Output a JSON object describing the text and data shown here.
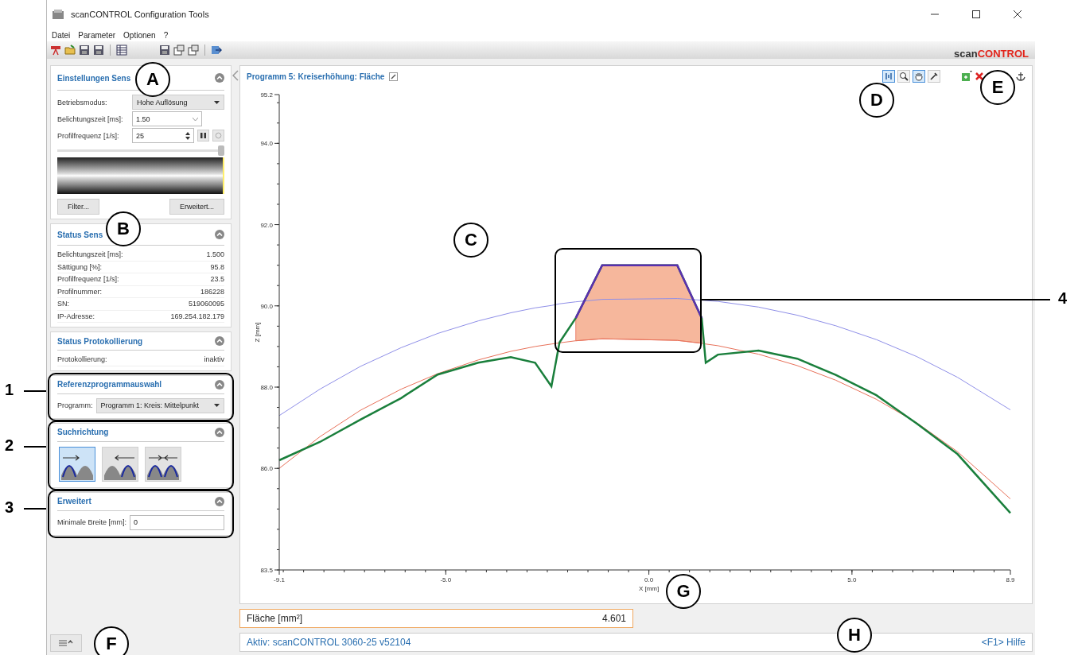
{
  "window": {
    "title": "scanCONTROL Configuration Tools"
  },
  "menu": [
    "Datei",
    "Parameter",
    "Optionen",
    "?"
  ],
  "logo": {
    "prefix": "scan",
    "suffix": "CONTROL"
  },
  "sensor_settings": {
    "title": "Einstellungen Sens",
    "expanded": true,
    "mode": {
      "label": "Betriebsmodus:",
      "value": "Hohe Auflösung"
    },
    "exposure": {
      "label": "Belichtungszeit [ms]:",
      "value": "1.50"
    },
    "frequency": {
      "label": "Profilfrequenz [1/s]:",
      "value": "25"
    },
    "slider": {
      "level": 1
    },
    "buttons": [
      "Filter...",
      "Erweitert..."
    ]
  },
  "sensor_status": {
    "title": "Status Sens",
    "expanded": true,
    "rows": [
      {
        "label": "Belichtungszeit [ms]:",
        "value": "1.500"
      },
      {
        "label": "Sättigung [%]:",
        "value": "95.8"
      },
      {
        "label": "Profilfrequenz [1/s]:",
        "value": "23.5"
      },
      {
        "label": "Profilnummer:",
        "value": "186228"
      },
      {
        "label": "SN:",
        "value": "519060095"
      },
      {
        "label": "IP-Adresse:",
        "value": "169.254.182.179"
      }
    ]
  },
  "logging_status": {
    "title": "Status Protokollierung",
    "expanded": true,
    "rows": [
      {
        "label": "Protokollierung:",
        "value": "inaktiv"
      }
    ]
  },
  "reference": {
    "title": "Referenzprogrammauswahl",
    "expanded": true,
    "label": "Programm:",
    "value": "Programm 1: Kreis: Mittelpunkt"
  },
  "search_direction": {
    "title": "Suchrichtung",
    "expanded": true,
    "options": [
      {
        "kind": "right",
        "selected": true
      },
      {
        "kind": "left",
        "selected": false
      },
      {
        "kind": "both",
        "selected": false
      }
    ]
  },
  "advanced": {
    "title": "Erweitert",
    "expanded": true,
    "label": "Minimale Breite [mm]:",
    "value": "0"
  },
  "chart": {
    "title": "Programm 5: Kreiserhöhung: Fläche",
    "tools": [
      {
        "kind": "fit",
        "selected": true
      },
      {
        "kind": "zoom",
        "selected": false
      },
      {
        "kind": "pan",
        "selected": true
      },
      {
        "kind": "pick",
        "selected": false
      }
    ],
    "chart_data": {
      "type": "line",
      "xlabel": "X [mm]",
      "ylabel": "Z [mm]",
      "x": [
        -9.1,
        -8.1,
        -7.1,
        -6.1,
        -5.2,
        -4.2,
        -3.4,
        -2.8,
        -2.4,
        -2.2,
        -1.8,
        -1.15,
        0.7,
        1.3,
        1.4,
        1.7,
        2.7,
        3.65,
        4.6,
        5.6,
        6.6,
        7.6,
        8.9
      ],
      "series": [
        {
          "color": "#8f8fe8",
          "values": [
            87.3,
            87.95,
            88.51,
            88.97,
            89.32,
            89.63,
            89.83,
            89.95,
            90.01,
            90.05,
            90.1,
            90.16,
            90.18,
            90.14,
            90.13,
            90.11,
            89.97,
            89.77,
            89.51,
            89.17,
            88.75,
            88.24,
            87.44
          ]
        },
        {
          "color": "#e8715a",
          "values": [
            86.0,
            86.78,
            87.43,
            87.95,
            88.33,
            88.67,
            88.88,
            89.0,
            89.06,
            89.09,
            89.14,
            89.19,
            89.15,
            89.08,
            89.06,
            89.02,
            88.81,
            88.53,
            88.17,
            87.7,
            87.12,
            86.41,
            85.25
          ]
        },
        {
          "color": "#1a7f3c",
          "values": [
            86.2,
            86.65,
            87.2,
            87.73,
            88.31,
            88.6,
            88.74,
            88.6,
            88.02,
            89.1,
            89.7,
            91.0,
            91.0,
            89.7,
            88.6,
            88.8,
            88.9,
            88.7,
            88.3,
            87.8,
            87.1,
            86.35,
            84.9
          ]
        },
        {
          "color": "#5b2fb0",
          "values": [
            null,
            null,
            null,
            null,
            null,
            null,
            null,
            null,
            null,
            null,
            89.7,
            91.0,
            91.0,
            89.7,
            null,
            null,
            null,
            null,
            null,
            null,
            null,
            null,
            null
          ]
        }
      ],
      "xlim": [
        -9.1,
        8.9
      ],
      "ylim": [
        83.5,
        95.2
      ],
      "xticks": [
        {
          "value": -9.1,
          "label": "-9.1"
        },
        {
          "value": -5,
          "label": "-5.0"
        },
        {
          "value": 0,
          "label": "0.0"
        },
        {
          "value": 5,
          "label": "5.0"
        },
        {
          "value": 8.9,
          "label": "8.9"
        }
      ],
      "yticks": [
        {
          "value": 83.5,
          "label": "83.5"
        },
        {
          "value": 86,
          "label": "86.0"
        },
        {
          "value": 88,
          "label": "88.0"
        },
        {
          "value": 90,
          "label": "90.0"
        },
        {
          "value": 92,
          "label": "92.0"
        },
        {
          "value": 94,
          "label": "94.0"
        },
        {
          "value": 95.2,
          "label": "95.2"
        }
      ]
    }
  },
  "result": {
    "label": "Fläche [mm²]",
    "value": "4.601"
  },
  "status_bar": {
    "text": "Aktiv: scanCONTROL 3060-25 v52104",
    "help": "<F1> Hilfe"
  },
  "callouts": [
    {
      "label": "A"
    },
    {
      "label": "B"
    },
    {
      "label": "C"
    },
    {
      "label": "D"
    },
    {
      "label": "E"
    },
    {
      "label": "F"
    },
    {
      "label": "G"
    },
    {
      "label": "H"
    }
  ],
  "numbered_callouts": [
    {
      "label": "1"
    },
    {
      "label": "2"
    },
    {
      "label": "3"
    },
    {
      "label": "4"
    }
  ]
}
